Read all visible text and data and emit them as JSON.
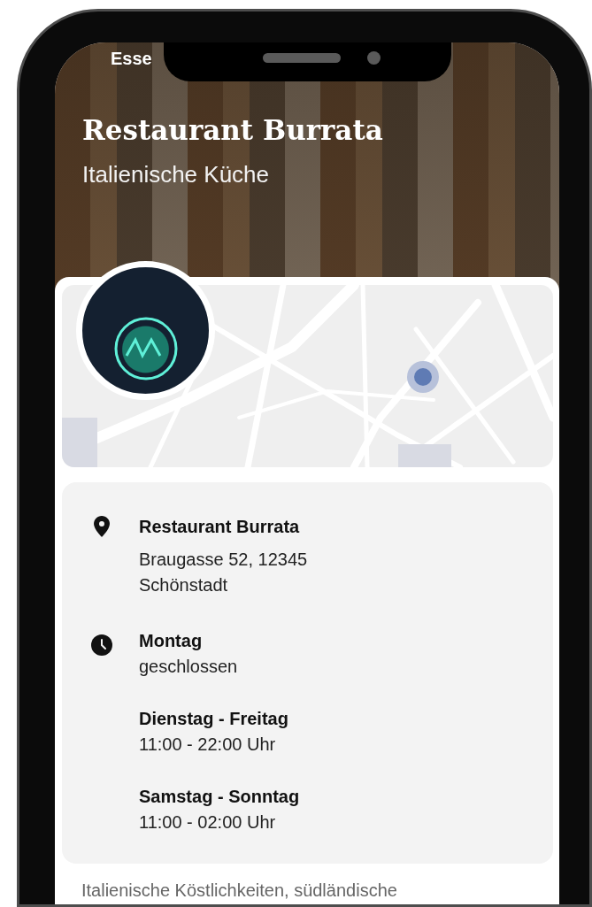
{
  "status_bar": {
    "text": "Esse"
  },
  "hero": {
    "title": "Restaurant Burrata",
    "subtitle": "Italienische Küche"
  },
  "info": [
    {
      "kind": "location",
      "blocks": [
        {
          "heading": "Restaurant Burrata",
          "lines": [
            "Braugasse 52, 12345",
            "Schönstadt"
          ]
        }
      ]
    },
    {
      "kind": "hours",
      "blocks": [
        {
          "heading": "Montag",
          "lines": [
            "geschlossen"
          ]
        },
        {
          "heading": "Dienstag - Freitag",
          "lines": [
            "11:00 - 22:00 Uhr"
          ]
        },
        {
          "heading": "Samstag - Sonntag",
          "lines": [
            "11:00 - 02:00 Uhr"
          ]
        }
      ]
    }
  ],
  "description": "Italienische Köstlichkeiten, südländische"
}
